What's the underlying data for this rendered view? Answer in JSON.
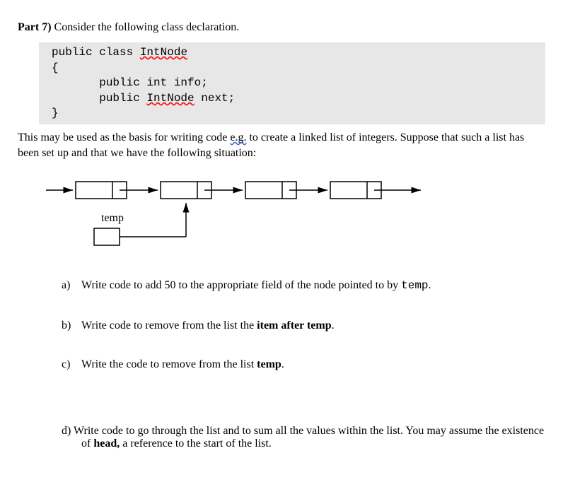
{
  "title": {
    "prefix": "Part 7)",
    "rest": " Consider the following class declaration."
  },
  "code": {
    "l1a": "public class ",
    "l1b": "IntNode",
    "l2": "{",
    "l3": "       public int info;",
    "l4a": "       public ",
    "l4b": "IntNode",
    "l4c": " next;",
    "l5": "}"
  },
  "para": {
    "a": "This may be used as the basis for writing code ",
    "eg": "e.g.",
    "b": " to create a linked list of integers. Suppose that such a list has been set up and that we have the following situation:"
  },
  "templabel": "temp",
  "q": {
    "a": {
      "label": "a)",
      "t1": "Write code to add 50 to the appropriate field of the node pointed to by ",
      "mono": "temp",
      "t2": "."
    },
    "b": {
      "label": "b)",
      "t1": "Write code to remove from the list the ",
      "bold": "item after temp",
      "t2": "."
    },
    "c": {
      "label": "c)",
      "t1": "Write the code to remove from the list ",
      "bold": "temp",
      "t2": "."
    },
    "d": {
      "label": "d)",
      "t1": "Write code to go through the list and to sum all the values within the list. You may assume the existence of ",
      "bold": "head,",
      "t2": " a reference to the start of the list."
    }
  }
}
